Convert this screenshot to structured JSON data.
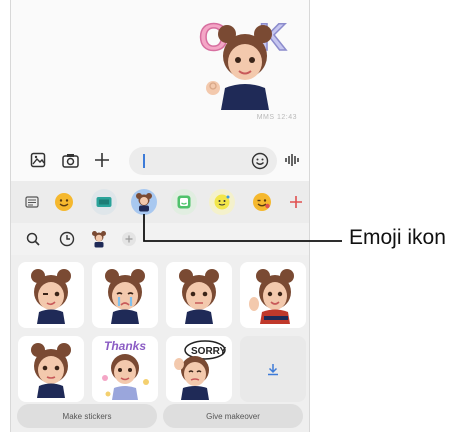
{
  "chat": {
    "timestamp": "MMS 12:43"
  },
  "composer": {
    "gallery": "gallery-icon",
    "camera": "camera-icon",
    "add": "plus-icon",
    "emoji": "smiley-icon",
    "voice": "voice-icon"
  },
  "categories": [
    "sticker-list-icon",
    "emoji-face-icon",
    "gif-icon",
    "ar-emoji-icon",
    "bitmoji-icon",
    "sticker-face-icon",
    "emoji-wink-icon",
    "add-icon"
  ],
  "subbar": [
    "search-icon",
    "recent-icon",
    "avatar-icon",
    "add-icon"
  ],
  "stickers": [
    {
      "name": "sticker-wink"
    },
    {
      "name": "sticker-cry"
    },
    {
      "name": "sticker-neutral"
    },
    {
      "name": "sticker-wave"
    },
    {
      "name": "sticker-plain"
    },
    {
      "name": "sticker-thanks"
    },
    {
      "name": "sticker-sorry"
    },
    {
      "name": "download-icon"
    }
  ],
  "buttons": {
    "make": "Make stickers",
    "give": "Give makeover"
  },
  "annotation": {
    "label": "Emoji ikon"
  },
  "colors": {
    "accent": "#3d7bd8",
    "selected": "#a8c8f0",
    "plus": "#e05050"
  }
}
